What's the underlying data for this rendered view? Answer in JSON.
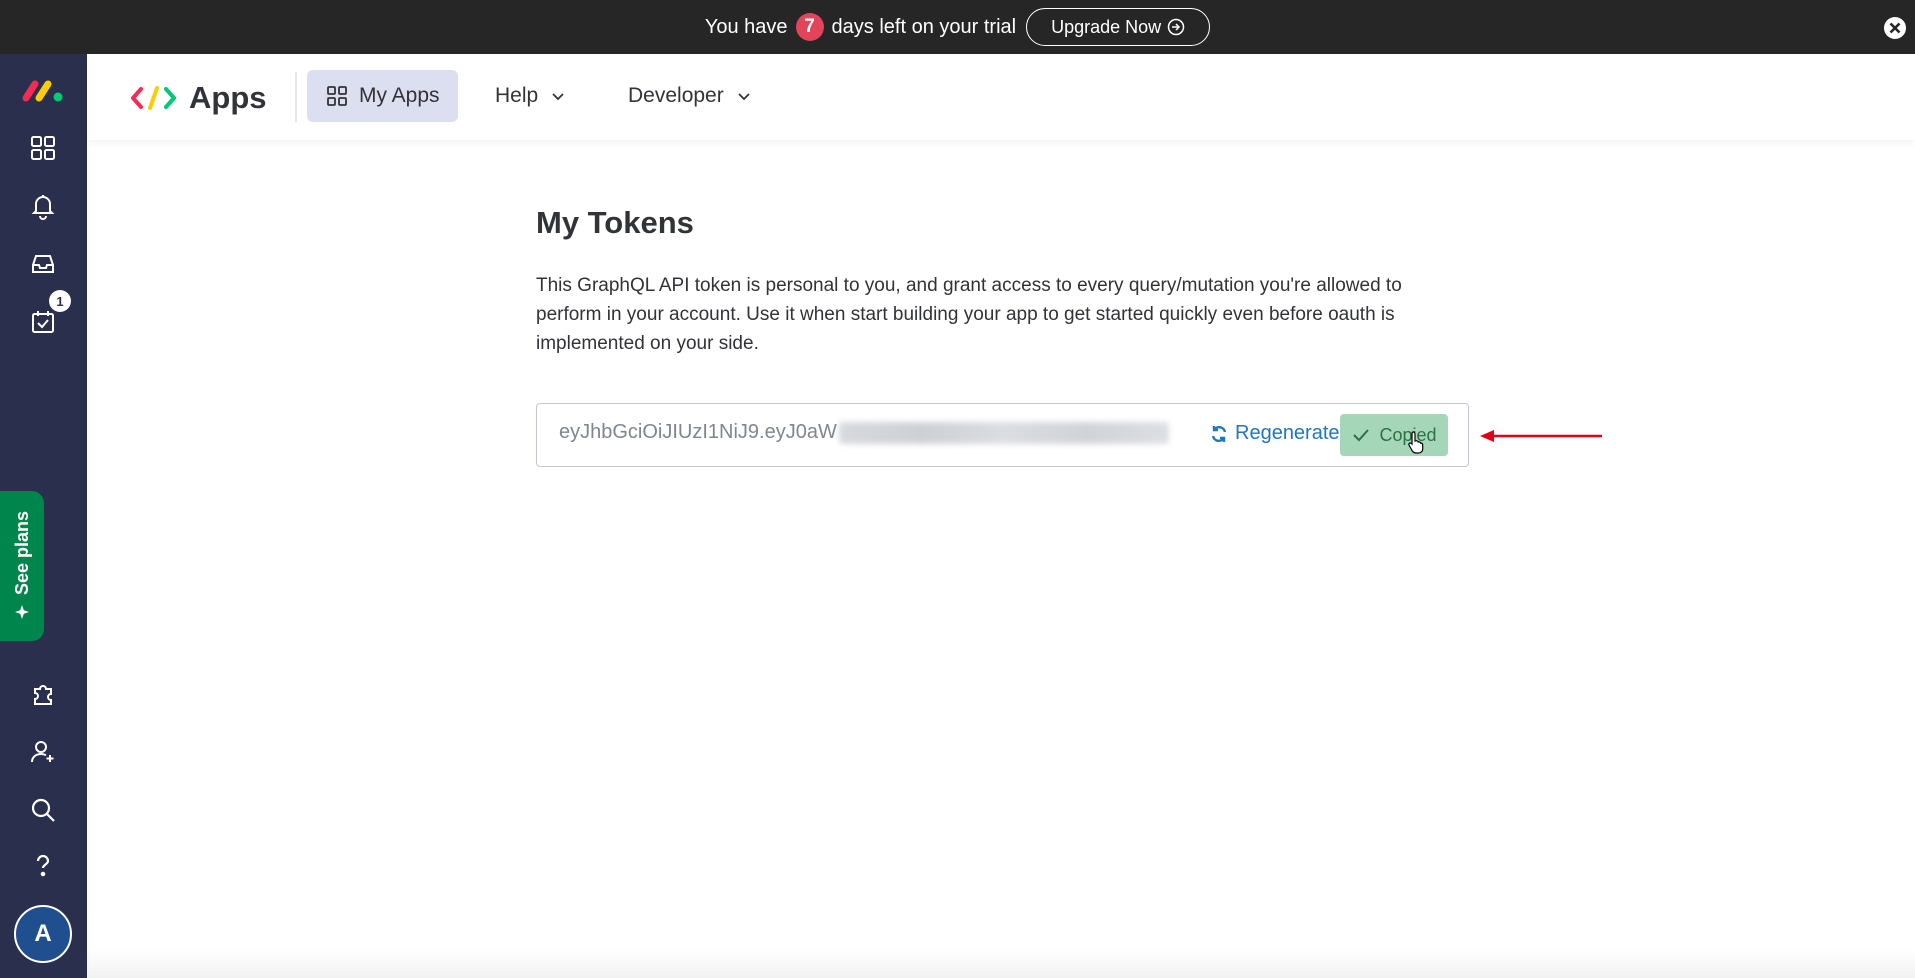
{
  "banner": {
    "prefix": "You have",
    "days": "7",
    "suffix": "days left on your trial",
    "upgrade_label": "Upgrade Now"
  },
  "sidebar": {
    "inbox_count": "1",
    "see_plans_label": "See plans",
    "avatar_letter": "A",
    "icons": [
      "monday-logo",
      "grid-icon",
      "bell-icon",
      "inbox-icon",
      "calendar-check-icon",
      "puzzle-icon",
      "add-user-icon",
      "search-icon",
      "help-icon"
    ]
  },
  "header": {
    "app_title": "Apps",
    "tabs": [
      {
        "label": "My Apps",
        "active": true
      },
      {
        "label": "Help"
      },
      {
        "label": "Developer"
      }
    ]
  },
  "main": {
    "title": "My Tokens",
    "description": "This GraphQL API token is personal to you, and grant access to every query/mutation you're allowed to perform in your account. Use it when start building your app to get started quickly even before oauth is implemented on your side.",
    "token_prefix": "eyJhbGciOiJIUzI1NiJ9.eyJ0aW",
    "regenerate_label": "Regenerate",
    "copied_label": "Copied"
  },
  "colors": {
    "banner_bg": "#262626",
    "sidebar_bg": "#292f4c",
    "badge_red": "#e2445c",
    "active_tab": "#dcdff0",
    "link_blue": "#1f76c2",
    "copied_bg": "#a5d6b8",
    "see_plans_green": "#00854d",
    "annotation_red": "#e3001b"
  }
}
